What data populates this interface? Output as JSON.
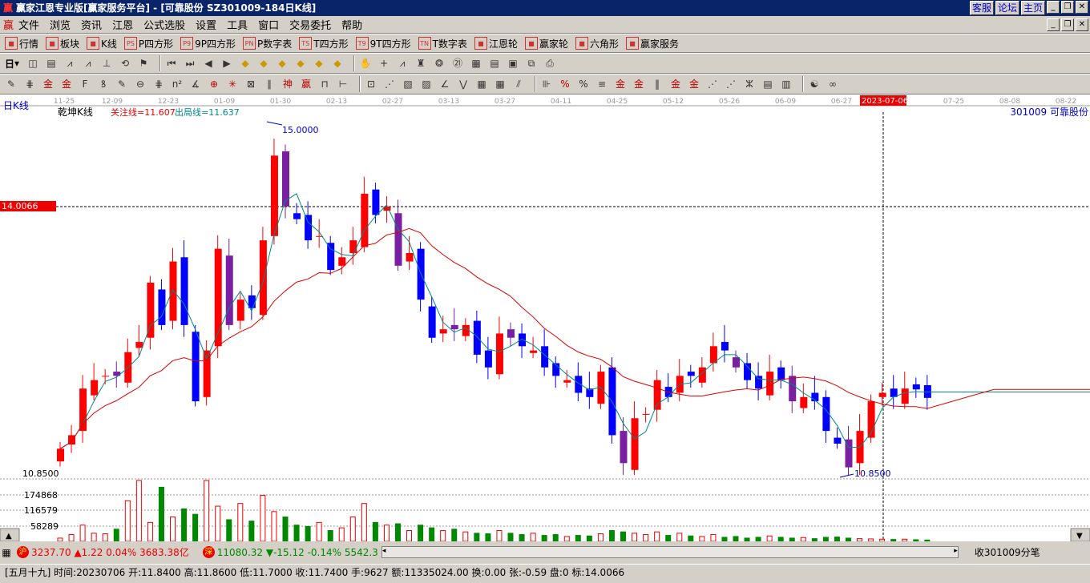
{
  "title": {
    "logo": "赢",
    "text": "赢家江恩专业版[赢家服务平台] - [可靠股份   SZ301009-184日K线]",
    "buttons": [
      "客服",
      "论坛",
      "主页"
    ]
  },
  "menu": {
    "logo": "赢",
    "items": [
      "文件",
      "浏览",
      "资讯",
      "江恩",
      "公式选股",
      "设置",
      "工具",
      "窗口",
      "交易委托",
      "帮助"
    ]
  },
  "toolbar1": [
    {
      "icon": "grid-table-icon",
      "label": "行情"
    },
    {
      "icon": "blocks-icon",
      "label": "板块"
    },
    {
      "icon": "candles-icon",
      "label": "K线"
    },
    {
      "icon": "ps-icon",
      "label": "P四方形",
      "glyph": "PS"
    },
    {
      "icon": "p9-icon",
      "label": "9P四方形",
      "glyph": "P9"
    },
    {
      "icon": "pn-icon",
      "label": "P数字表",
      "glyph": "PN"
    },
    {
      "icon": "ts-icon",
      "label": "T四方形",
      "glyph": "TS"
    },
    {
      "icon": "t9-icon",
      "label": "9T四方形",
      "glyph": "T9"
    },
    {
      "icon": "tn-icon",
      "label": "T数字表",
      "glyph": "TN"
    },
    {
      "icon": "gann-wheel-icon",
      "label": "江恩轮"
    },
    {
      "icon": "winner-wheel-icon",
      "label": "赢家轮"
    },
    {
      "icon": "hexagon-icon",
      "label": "六角形"
    },
    {
      "icon": "dollar-icon",
      "label": "赢家服务"
    }
  ],
  "period": "日",
  "chart": {
    "period_label": "日K线",
    "indicator_name": "乾坤K线",
    "line1": "关注线=11.607",
    "line2": "出局线=11.637",
    "stock_label": "301009  可靠股份",
    "high_label": "15.0000",
    "low_label": "10.8500",
    "crosshair_price": "14.0066",
    "selected_date": "2023-07-06",
    "dates": [
      "11-25",
      "12-09",
      "12-23",
      "01-09",
      "01-30",
      "02-13",
      "02-27",
      "03-13",
      "03-27",
      "04-11",
      "04-25",
      "05-12",
      "05-26",
      "06-09",
      "06-27",
      "07-25",
      "08-08",
      "08-22"
    ],
    "price_axis": [
      "10.8500"
    ],
    "volume_axis": [
      "174868",
      "116579",
      "58289"
    ]
  },
  "chart_data": {
    "type": "candlestick",
    "ylim": [
      10.85,
      15.0
    ],
    "closes": [
      11.14,
      11.3,
      11.85,
      11.95,
      12.0,
      12.0,
      12.28,
      12.4,
      13.1,
      12.6,
      13.35,
      12.6,
      11.7,
      12.3,
      13.5,
      12.6,
      12.9,
      12.8,
      13.6,
      14.6,
      14.0,
      13.85,
      13.6,
      13.65,
      13.25,
      13.4,
      13.6,
      14.15,
      13.9,
      14.0,
      13.3,
      13.45,
      12.9,
      12.45,
      12.55,
      12.55,
      12.6,
      12.25,
      12.1,
      12.5,
      12.45,
      12.35,
      12.3,
      12.1,
      12.0,
      11.95,
      11.8,
      11.75,
      12.05,
      11.3,
      10.97,
      11.5,
      11.55,
      11.95,
      11.75,
      12.0,
      12.0,
      12.1,
      12.35,
      12.3,
      12.1,
      11.95,
      11.85,
      12.05,
      11.95,
      11.7,
      11.75,
      11.7,
      11.35,
      11.2,
      10.92,
      11.35,
      11.7,
      11.8,
      11.75,
      11.85,
      11.84,
      11.74
    ],
    "volumes": [
      12000,
      25000,
      60000,
      30000,
      28000,
      45000,
      150000,
      225000,
      70000,
      200000,
      90000,
      120000,
      100000,
      225000,
      130000,
      80000,
      140000,
      75000,
      170000,
      110000,
      90000,
      60000,
      55000,
      70000,
      40000,
      50000,
      90000,
      140000,
      70000,
      60000,
      65000,
      40000,
      60000,
      50000,
      40000,
      45000,
      35000,
      30000,
      28000,
      40000,
      30000,
      25000,
      30000,
      22000,
      25000,
      18000,
      22000,
      20000,
      28000,
      40000,
      35000,
      30000,
      25000,
      35000,
      22000,
      30000,
      20000,
      18000,
      25000,
      15000,
      18000,
      12000,
      15000,
      20000,
      15000,
      12000,
      14000,
      10000,
      15000,
      16000,
      12000,
      10000,
      9000,
      8000,
      7000,
      8000,
      6000,
      5000
    ]
  },
  "status": {
    "sh_badge": "沪",
    "sh_text": "3237.70 ▲1.22 0.04% 3683.38亿",
    "sz_badge": "深",
    "sz_text": "11080.32 ▼-15.12 -0.14% 5542.3",
    "right": "收301009分笔"
  },
  "info": "[五月十九] 时间:20230706 开:11.8400 高:11.8600 低:11.7000 收:11.7400 手:9627 额:11335024.00 换:0.00 张:-0.59 盘:0 标:14.0066"
}
